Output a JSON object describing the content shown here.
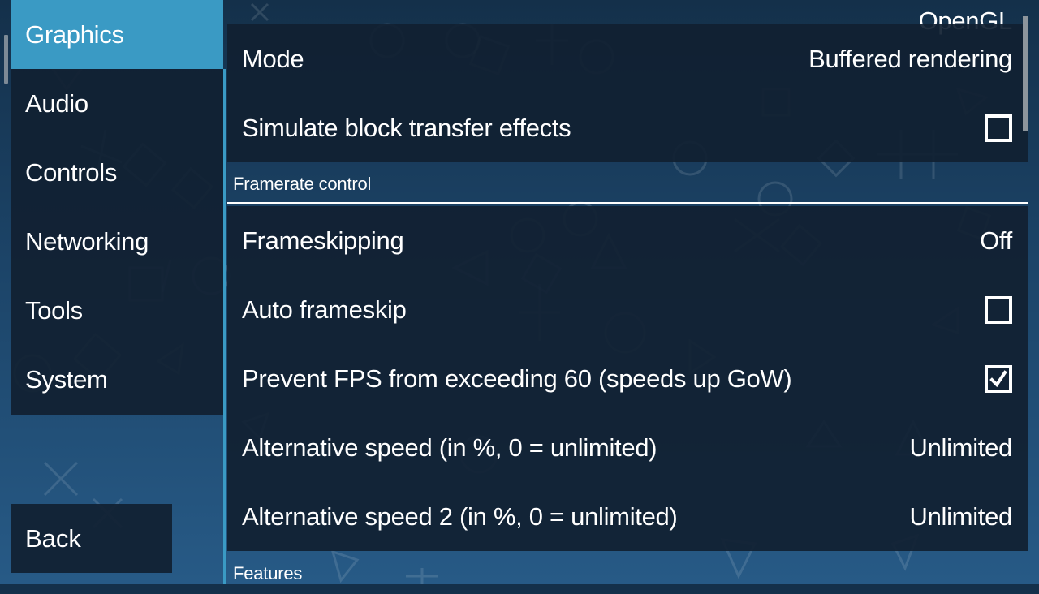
{
  "sidebar": {
    "items": [
      {
        "label": "Graphics",
        "active": true
      },
      {
        "label": "Audio",
        "active": false
      },
      {
        "label": "Controls",
        "active": false
      },
      {
        "label": "Networking",
        "active": false
      },
      {
        "label": "Tools",
        "active": false
      },
      {
        "label": "System",
        "active": false
      }
    ],
    "back_label": "Back"
  },
  "panel": {
    "cut_off_value": "OpenGL",
    "rows_top": [
      {
        "label": "Mode",
        "value": "Buffered rendering",
        "type": "choice"
      },
      {
        "label": "Simulate block transfer effects",
        "checked": false,
        "type": "checkbox"
      }
    ],
    "section_framerate": "Framerate control",
    "rows_framerate": [
      {
        "label": "Frameskipping",
        "value": "Off",
        "type": "choice"
      },
      {
        "label": "Auto frameskip",
        "checked": false,
        "type": "checkbox"
      },
      {
        "label": "Prevent FPS from exceeding 60 (speeds up GoW)",
        "checked": true,
        "type": "checkbox"
      },
      {
        "label": "Alternative speed (in %, 0 = unlimited)",
        "value": "Unlimited",
        "type": "choice"
      },
      {
        "label": "Alternative speed 2 (in %, 0 = unlimited)",
        "value": "Unlimited",
        "type": "choice"
      }
    ],
    "section_features": "Features"
  },
  "colors": {
    "accent": "#3a9ac4",
    "panel_bg": "#112032",
    "text": "#ffffff"
  }
}
